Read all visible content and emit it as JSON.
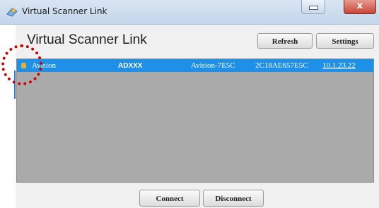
{
  "window": {
    "title": "Virtual Scanner Link",
    "close_glyph": "x"
  },
  "app": {
    "heading": "Virtual Scanner Link"
  },
  "toolbar": {
    "refresh_label": "Refresh",
    "settings_label": "Settings"
  },
  "scanner_list": {
    "rows": [
      {
        "name": "Avision",
        "model": "ADXXX",
        "host": "Avision-7E5C",
        "mac": "2C18AE657E5C",
        "ip": "10.1.23.22",
        "selected": true
      }
    ]
  },
  "footer": {
    "connect_label": "Connect",
    "disconnect_label": "Disconnect"
  },
  "colors": {
    "selection": "#1e90e8",
    "list_background": "#aaaaaa",
    "annotation_circle": "#c90000"
  },
  "icons": [
    "scanner-app-icon",
    "minimize-icon",
    "close-icon",
    "scanner-device-icon"
  ]
}
